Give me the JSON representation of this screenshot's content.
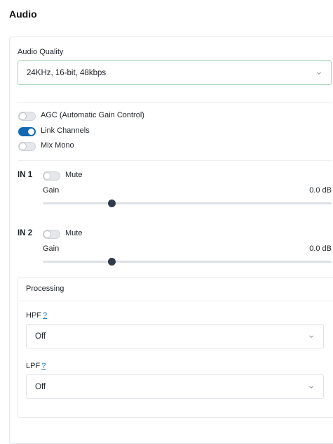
{
  "page": {
    "title": "Audio"
  },
  "audio_quality": {
    "label": "Audio Quality",
    "value": "24KHz, 16-bit, 48kbps"
  },
  "toggles": {
    "agc": {
      "label": "AGC (Automatic Gain Control)",
      "on": false
    },
    "link_channels": {
      "label": "Link Channels",
      "on": true
    },
    "mix_mono": {
      "label": "Mix Mono",
      "on": false
    }
  },
  "inputs": [
    {
      "label": "IN 1",
      "mute_label": "Mute",
      "mute_on": false,
      "gain_label": "Gain",
      "gain_value": "0.0 dB",
      "gain_fraction": 0.24
    },
    {
      "label": "IN 2",
      "mute_label": "Mute",
      "mute_on": false,
      "gain_label": "Gain",
      "gain_value": "0.0 dB",
      "gain_fraction": 0.24
    }
  ],
  "processing": {
    "title": "Processing",
    "hpf": {
      "label": "HPF",
      "help": "?",
      "value": "Off"
    },
    "lpf": {
      "label": "LPF",
      "help": "?",
      "value": "Off"
    }
  },
  "colors": {
    "accent": "#1268b3",
    "selected_border": "#a8d5b8",
    "help_link": "#1a73c9",
    "slider_thumb": "#2f3a4a"
  }
}
